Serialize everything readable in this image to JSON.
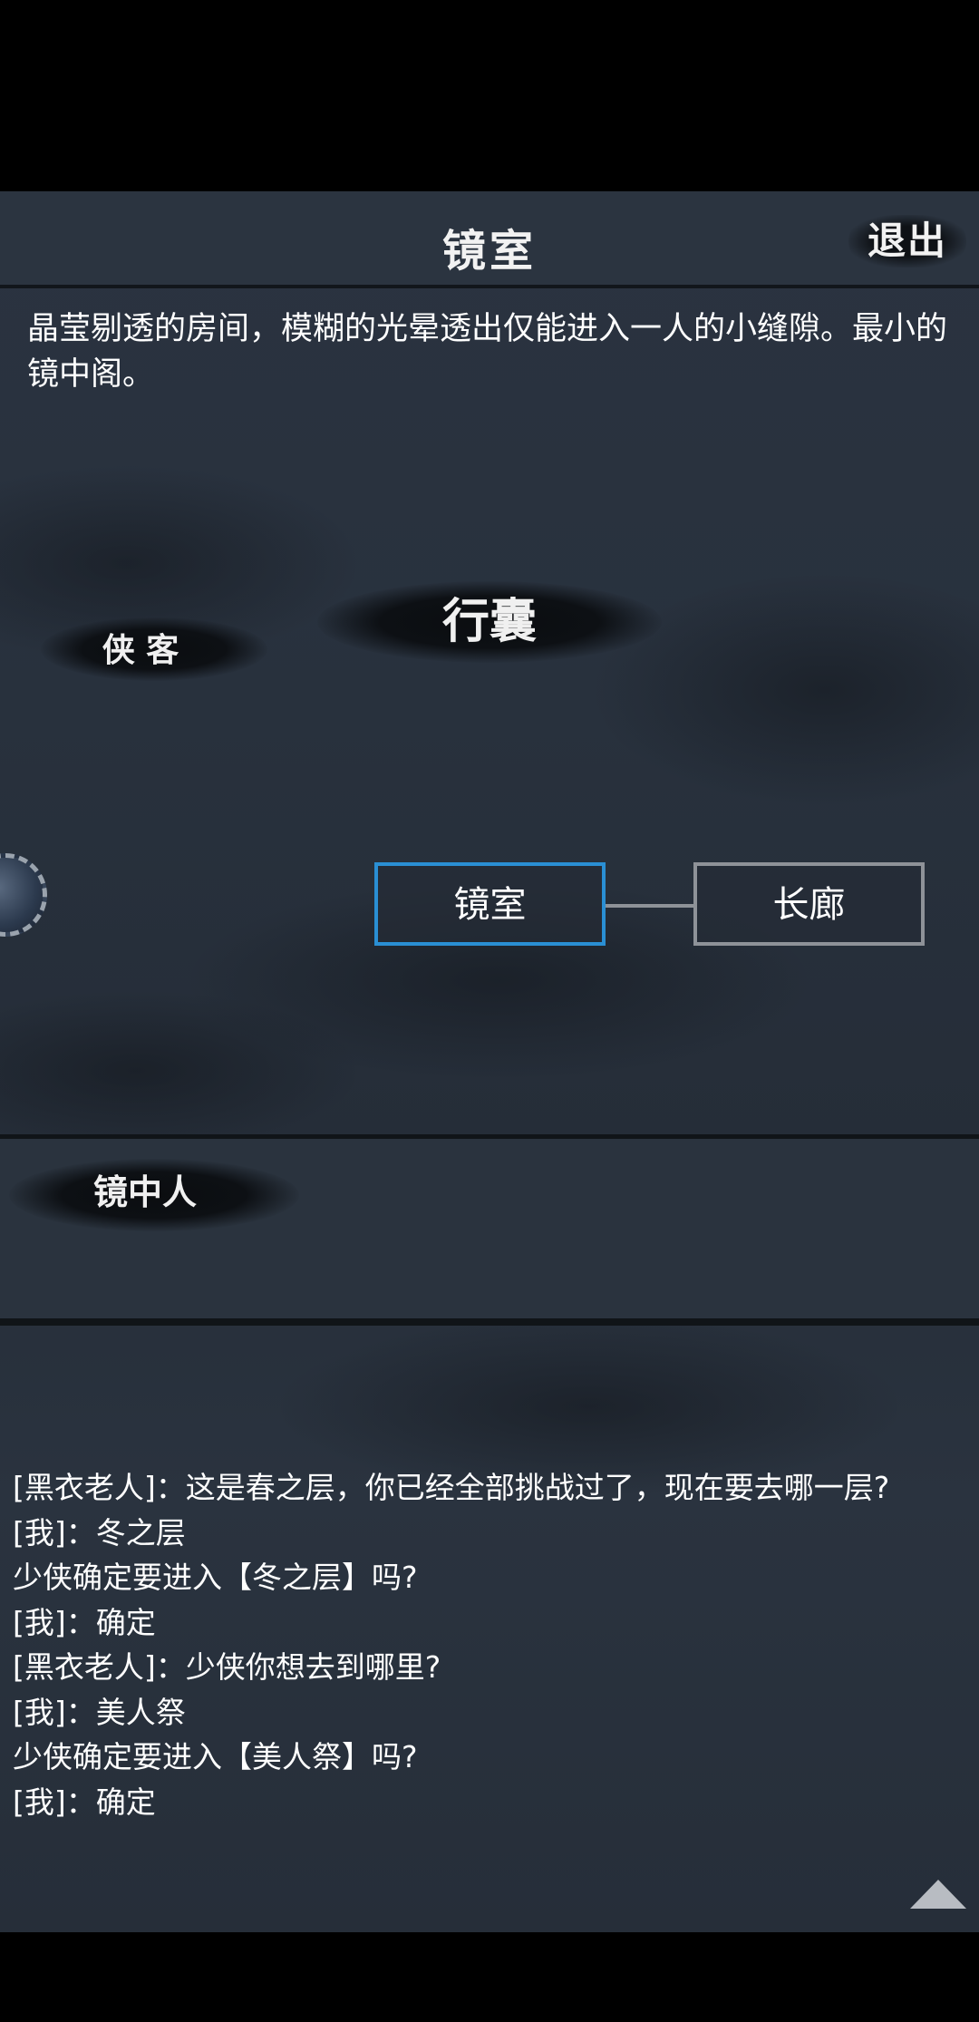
{
  "header": {
    "title": "镜室",
    "exit_label": "退出"
  },
  "room": {
    "description": "晶莹剔透的房间，模糊的光晕透出仅能进入一人的小缝隙。最小的镜中阁。"
  },
  "menu": {
    "bag_label": "行囊",
    "hero_label": "侠 客"
  },
  "map": {
    "current_room": "镜室",
    "adjacent_room": "长廊",
    "current_color": "#2a8fd4"
  },
  "npc_section": {
    "label": "镜中人"
  },
  "log": {
    "lines": [
      "[黑衣老人]：这是春之层，你已经全部挑战过了，现在要去哪一层?",
      "[我]：冬之层",
      "少侠确定要进入【冬之层】吗?",
      "[我]：确定",
      "[黑衣老人]：少侠你想去到哪里?",
      "[我]：美人祭",
      "少侠确定要进入【美人祭】吗?",
      "[我]：确定"
    ]
  }
}
